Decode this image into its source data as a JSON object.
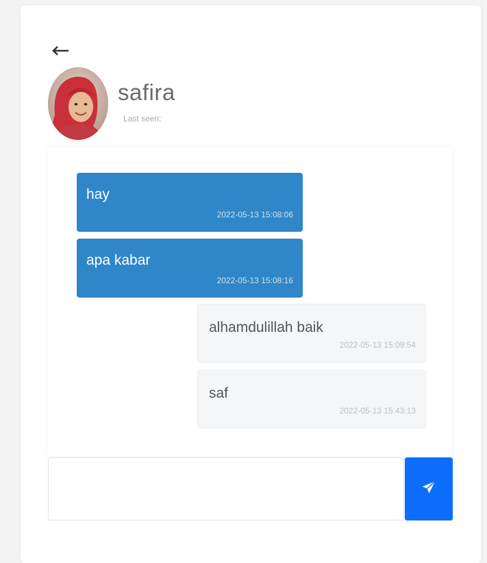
{
  "header": {
    "contact_name": "safira",
    "status": "Last seen:"
  },
  "messages": [
    {
      "direction": "received",
      "text": "hay",
      "time": "2022-05-13 15:08:06"
    },
    {
      "direction": "received",
      "text": "apa kabar",
      "time": "2022-05-13 15:08:16"
    },
    {
      "direction": "sent",
      "text": "alhamdulillah baik",
      "time": "2022-05-13 15:09:54"
    },
    {
      "direction": "sent",
      "text": "saf",
      "time": "2022-05-13 15:43:13"
    }
  ],
  "composer": {
    "value": "",
    "placeholder": ""
  },
  "icons": {
    "back": "arrow-left-icon",
    "send": "paper-plane-icon"
  },
  "colors": {
    "received_bubble": "#2f86c8",
    "sent_bubble": "#f5f6f8",
    "send_button": "#0d6efd"
  }
}
